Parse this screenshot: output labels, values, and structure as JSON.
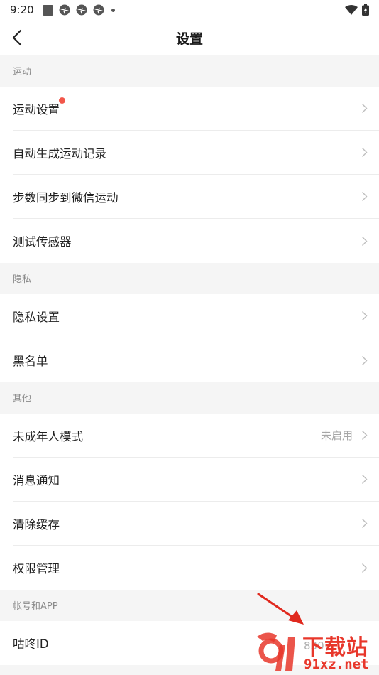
{
  "status_bar": {
    "time": "9:20"
  },
  "header": {
    "title": "设置"
  },
  "sections": [
    {
      "title": "运动",
      "items": [
        {
          "label": "运动设置",
          "badge": true
        },
        {
          "label": "自动生成运动记录"
        },
        {
          "label": "步数同步到微信运动"
        },
        {
          "label": "测试传感器"
        }
      ]
    },
    {
      "title": "隐私",
      "items": [
        {
          "label": "隐私设置"
        },
        {
          "label": "黑名单"
        }
      ]
    },
    {
      "title": "其他",
      "items": [
        {
          "label": "未成年人模式",
          "value": "未启用"
        },
        {
          "label": "消息通知"
        },
        {
          "label": "清除缓存"
        },
        {
          "label": "权限管理"
        }
      ]
    },
    {
      "title": "帐号和APP",
      "items": [
        {
          "label": "咕咚ID",
          "value": "8307"
        }
      ]
    }
  ],
  "watermark": {
    "top": "下载站",
    "bottom": "91xz.net"
  },
  "colors": {
    "accent_red": "#f2564a",
    "watermark_red": "#e8372b",
    "background": "#f5f5f5"
  }
}
